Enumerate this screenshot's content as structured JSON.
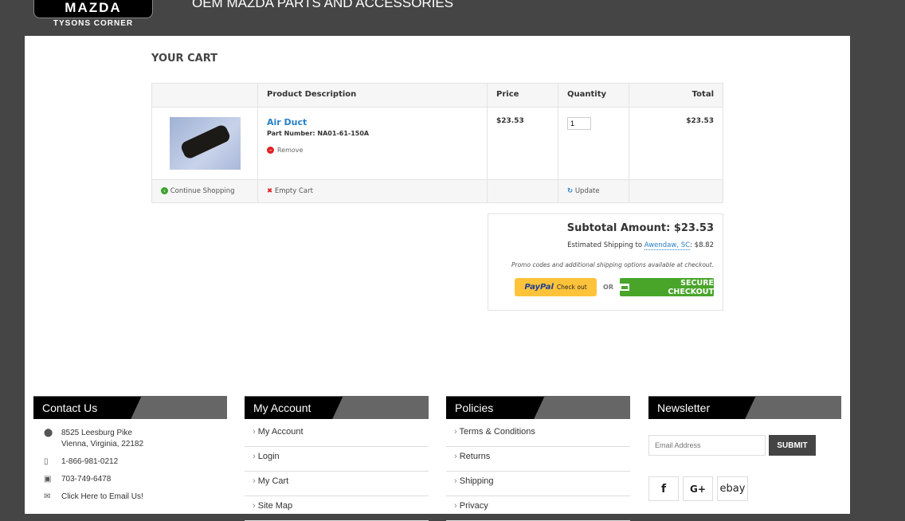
{
  "header": {
    "logo": "MAZDA",
    "logo_sub": "TYSONS CORNER",
    "tagline": "OEM MAZDA PARTS AND ACCESSORIES"
  },
  "cart": {
    "title": "YOUR CART",
    "columns": [
      "",
      "Product Description",
      "Price",
      "Quantity",
      "Total"
    ],
    "item": {
      "name": "Air Duct",
      "part_number": "Part Number: NA01-61-150A",
      "remove": "Remove",
      "price": "$23.53",
      "quantity": "1",
      "total": "$23.53"
    },
    "actions": {
      "continue": "Continue Shopping",
      "empty": "Empty Cart",
      "update": "Update"
    }
  },
  "summary": {
    "subtotal": "Subtotal Amount: $23.53",
    "shipping_prefix": "Estimated Shipping to ",
    "shipping_location": "Awendaw, SC",
    "shipping_cost": ": $8.82",
    "promo": "Promo codes and additional shipping options available at checkout.",
    "paypal": "PayPal",
    "paypal_checkout": "Check out",
    "or": "OR",
    "secure": "SECURE CHECKOUT"
  },
  "footer": {
    "contact": {
      "title": "Contact Us",
      "address1": "8525 Leesburg Pike",
      "address2": "Vienna, Virginia, 22182",
      "phone": "1-866-981-0212",
      "fax": "703-749-6478",
      "email": "Click Here to Email Us!"
    },
    "account": {
      "title": "My Account",
      "links": [
        "My Account",
        "Login",
        "My Cart",
        "Site Map"
      ]
    },
    "policies": {
      "title": "Policies",
      "links": [
        "Terms & Conditions",
        "Returns",
        "Shipping",
        "Privacy"
      ]
    },
    "newsletter": {
      "title": "Newsletter",
      "placeholder": "Email Address",
      "submit": "SUBMIT",
      "social": [
        "f",
        "G+",
        "ebay"
      ]
    }
  }
}
